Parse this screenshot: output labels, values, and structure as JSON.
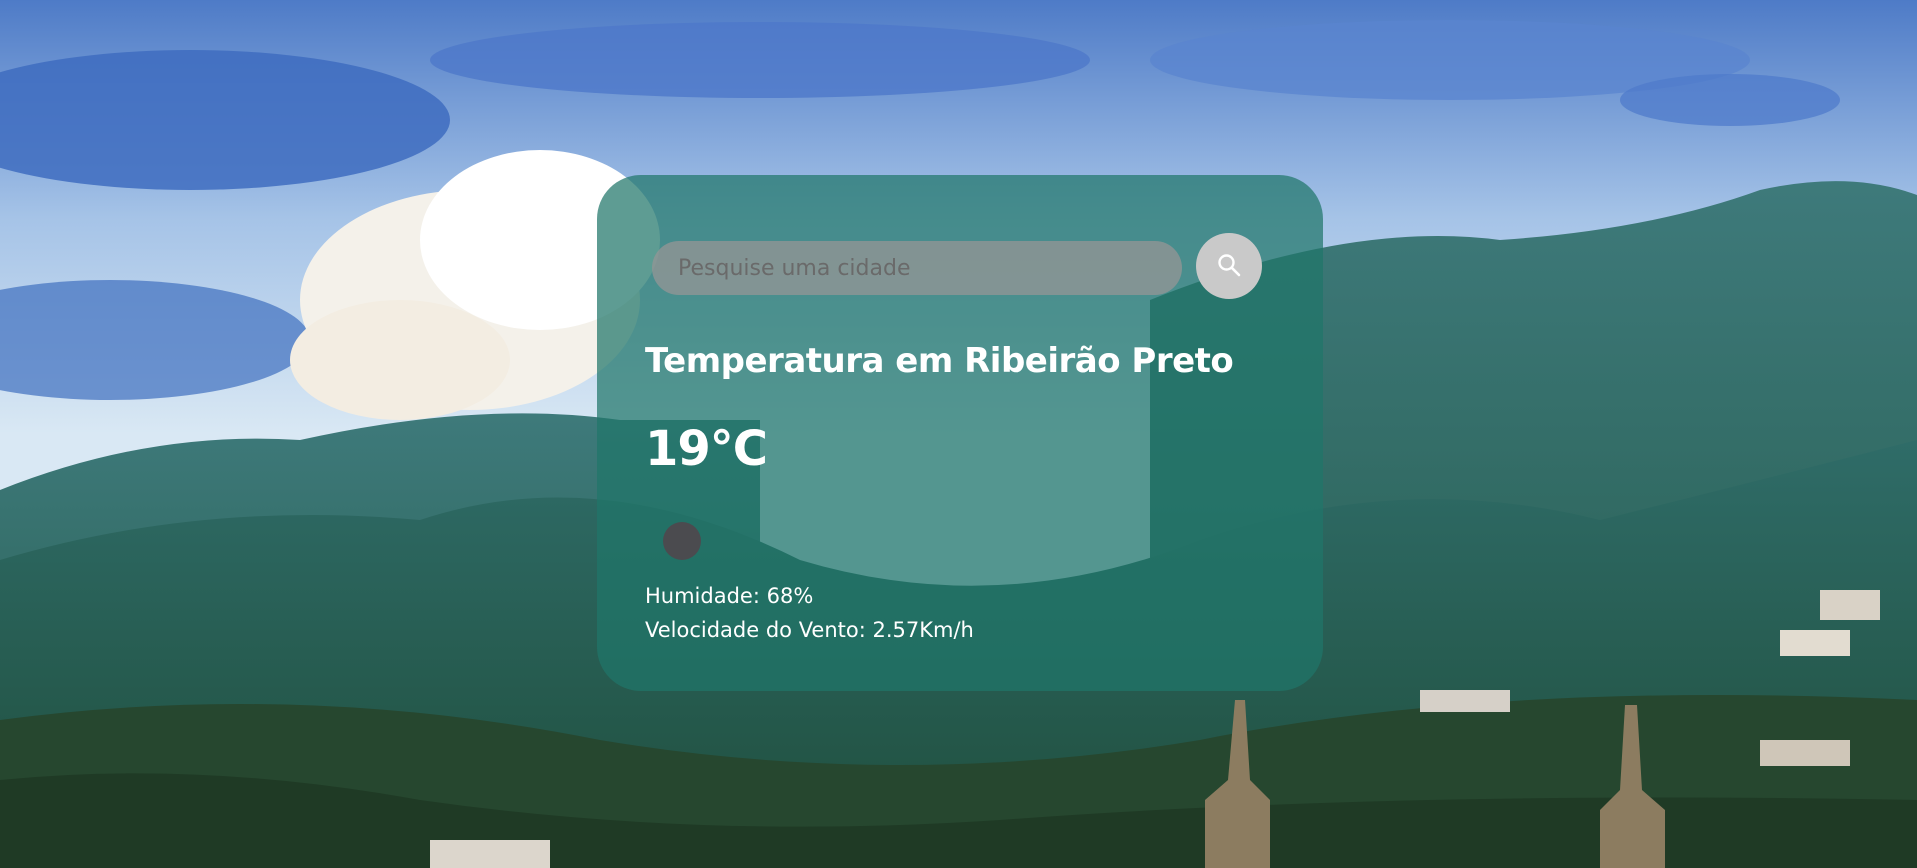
{
  "search": {
    "placeholder": "Pesquise uma cidade",
    "button_icon": "search-icon"
  },
  "weather": {
    "title": "Temperatura em Ribeirão Preto",
    "temperature": "19°C",
    "condition_icon": "weather-condition-icon",
    "humidity": "Humidade: 68%",
    "wind": "Velocidade do Vento: 2.57Km/h"
  },
  "colors": {
    "card_background": "#20766a",
    "search_field": "#969696",
    "search_button": "#c9c9c9",
    "text": "#ffffff"
  }
}
